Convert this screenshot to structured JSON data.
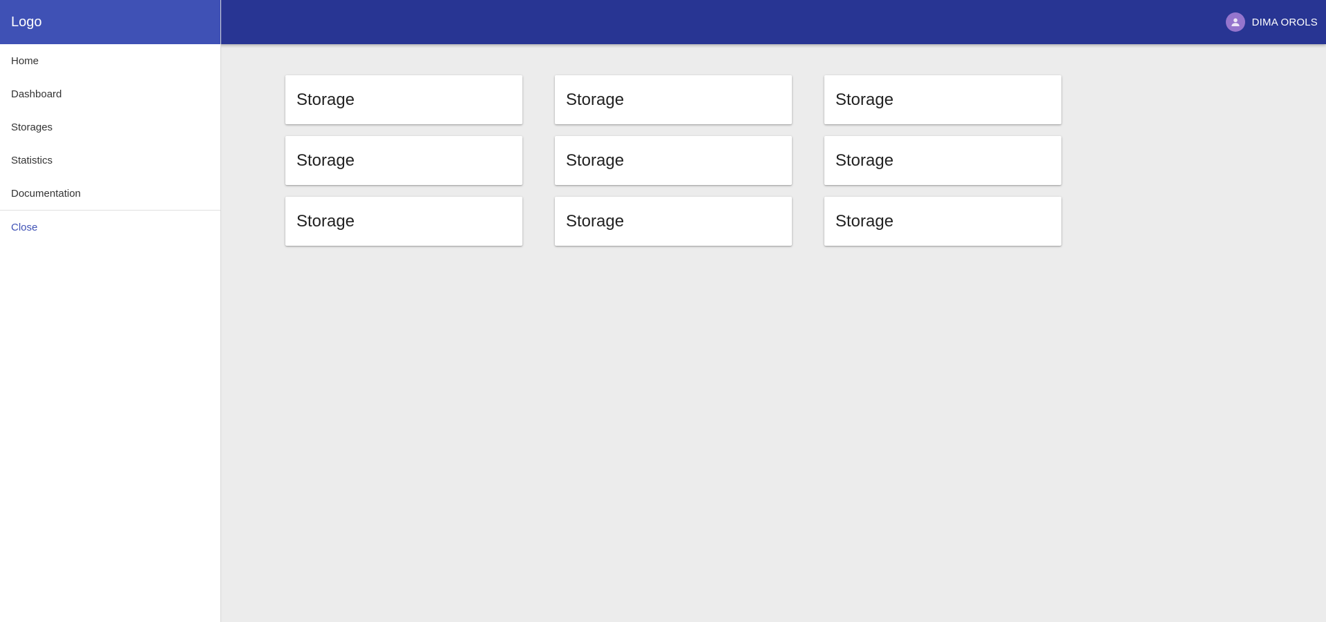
{
  "header": {
    "logo": "Logo",
    "user_name": "DIMA OROLS",
    "avatar_icon": "person-icon"
  },
  "sidebar": {
    "items": [
      {
        "label": "Home"
      },
      {
        "label": "Dashboard"
      },
      {
        "label": "Storages"
      },
      {
        "label": "Statistics"
      },
      {
        "label": "Documentation"
      }
    ],
    "close_label": "Close"
  },
  "main": {
    "cards": [
      {
        "title": "Storage"
      },
      {
        "title": "Storage"
      },
      {
        "title": "Storage"
      },
      {
        "title": "Storage"
      },
      {
        "title": "Storage"
      },
      {
        "title": "Storage"
      },
      {
        "title": "Storage"
      },
      {
        "title": "Storage"
      },
      {
        "title": "Storage"
      }
    ]
  },
  "colors": {
    "topbar": "#283593",
    "sidebar_header": "#3f51b5",
    "avatar": "#9575cd",
    "close_link": "#3f51b5",
    "background": "#ececec"
  }
}
